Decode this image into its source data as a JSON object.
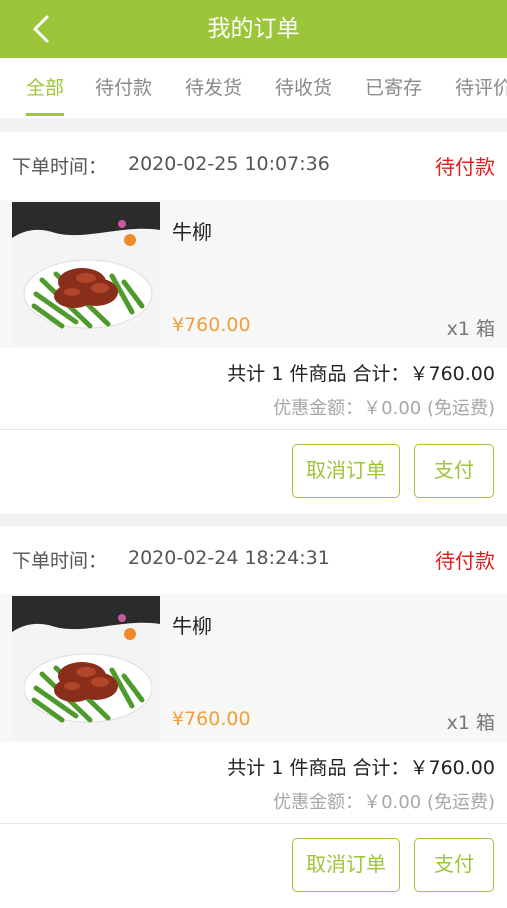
{
  "header": {
    "title": "我的订单",
    "back_icon": "chevron-left-icon"
  },
  "tabs": [
    "全部",
    "待付款",
    "待发货",
    "待收货",
    "已寄存",
    "待评价"
  ],
  "orders": [
    {
      "time_label": "下单时间：",
      "time_value": "2020-02-25 10:07:36",
      "status": "待付款",
      "item_name": "牛柳",
      "price": "¥760.00",
      "quantity": "x1 箱",
      "summary": "共计 1 件商品  合计：￥760.00",
      "discount": "优惠金额：￥0.00 (免运费)",
      "cancel_label": "取消订单",
      "pay_label": "支付"
    },
    {
      "time_label": "下单时间：",
      "time_value": "2020-02-24 18:24:31",
      "status": "待付款",
      "item_name": "牛柳",
      "price": "¥760.00",
      "quantity": "x1 箱",
      "summary": "共计 1 件商品  合计：￥760.00",
      "discount": "优惠金额：￥0.00 (免运费)",
      "cancel_label": "取消订单",
      "pay_label": "支付"
    }
  ],
  "colors": {
    "brand": "#9cc53a",
    "status": "#e02020",
    "price": "#f0a037"
  }
}
